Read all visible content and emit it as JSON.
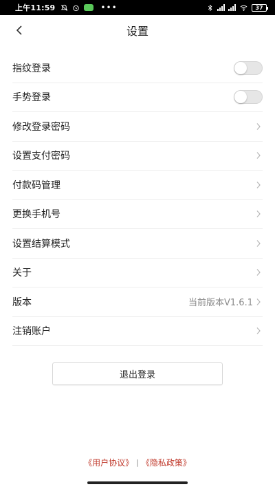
{
  "status_bar": {
    "time": "上午11:59",
    "battery": "37"
  },
  "navbar": {
    "title": "设置"
  },
  "settings": [
    {
      "label": "指纹登录",
      "type": "toggle",
      "on": false
    },
    {
      "label": "手势登录",
      "type": "toggle",
      "on": false
    },
    {
      "label": "修改登录密码",
      "type": "link"
    },
    {
      "label": "设置支付密码",
      "type": "link"
    },
    {
      "label": "付款码管理",
      "type": "link"
    },
    {
      "label": "更换手机号",
      "type": "link"
    },
    {
      "label": "设置结算模式",
      "type": "link"
    },
    {
      "label": "关于",
      "type": "link"
    },
    {
      "label": "版本",
      "type": "link",
      "value": "当前版本V1.6.1"
    },
    {
      "label": "注销账户",
      "type": "link"
    }
  ],
  "logout_label": "退出登录",
  "footer": {
    "user_agreement": "《用户协议》",
    "separator": "|",
    "privacy_policy": "《隐私政策》"
  },
  "colors": {
    "footer_link": "#c0392b",
    "status_bar_bg": "#000000",
    "wechat_green": "#5ac85a"
  }
}
